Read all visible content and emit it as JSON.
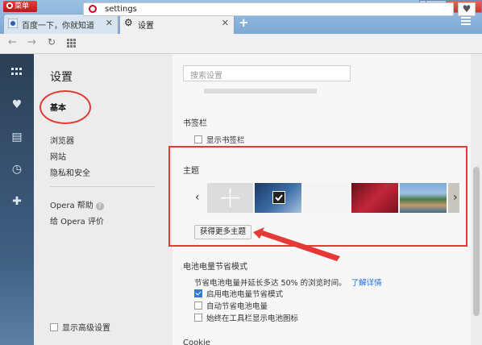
{
  "window": {
    "menu_button_label": "菜单",
    "minimize_glyph": "─",
    "maximize_glyph": "□",
    "close_glyph": "✕"
  },
  "tabs": [
    {
      "label": "百度一下，你就知道",
      "close": "✕"
    },
    {
      "label": "设置",
      "close": "✕"
    }
  ],
  "toolbar": {
    "url": "settings",
    "new_tab_glyph": "+"
  },
  "sidebar": {
    "title": "设置",
    "selected": "基本",
    "items": [
      "浏览器",
      "网站",
      "隐私和安全"
    ],
    "help": "Opera 帮助",
    "help_q": "?",
    "rate": "给 Opera 评价",
    "advanced": "显示高级设置"
  },
  "main": {
    "search_placeholder": "搜索设置",
    "bookmarks_title": "书签栏",
    "show_bookmarks": "显示书签栏",
    "themes_title": "主题",
    "get_more_themes": "获得更多主题",
    "battery_title": "电池电量节省模式",
    "battery_desc": "节省电池电量并延长多达 50% 的浏览时间。",
    "learn_more": "了解详情",
    "battery_options": [
      "启用电池电量节省模式",
      "自动节省电池电量",
      "始终在工具栏显示电池图标"
    ],
    "battery_checked": [
      true,
      false,
      false
    ],
    "cookies_title": "Cookie"
  },
  "colors": {
    "annotation_red": "#e53935",
    "opera_red": "#d0021b",
    "link_blue": "#1a6fd1"
  }
}
